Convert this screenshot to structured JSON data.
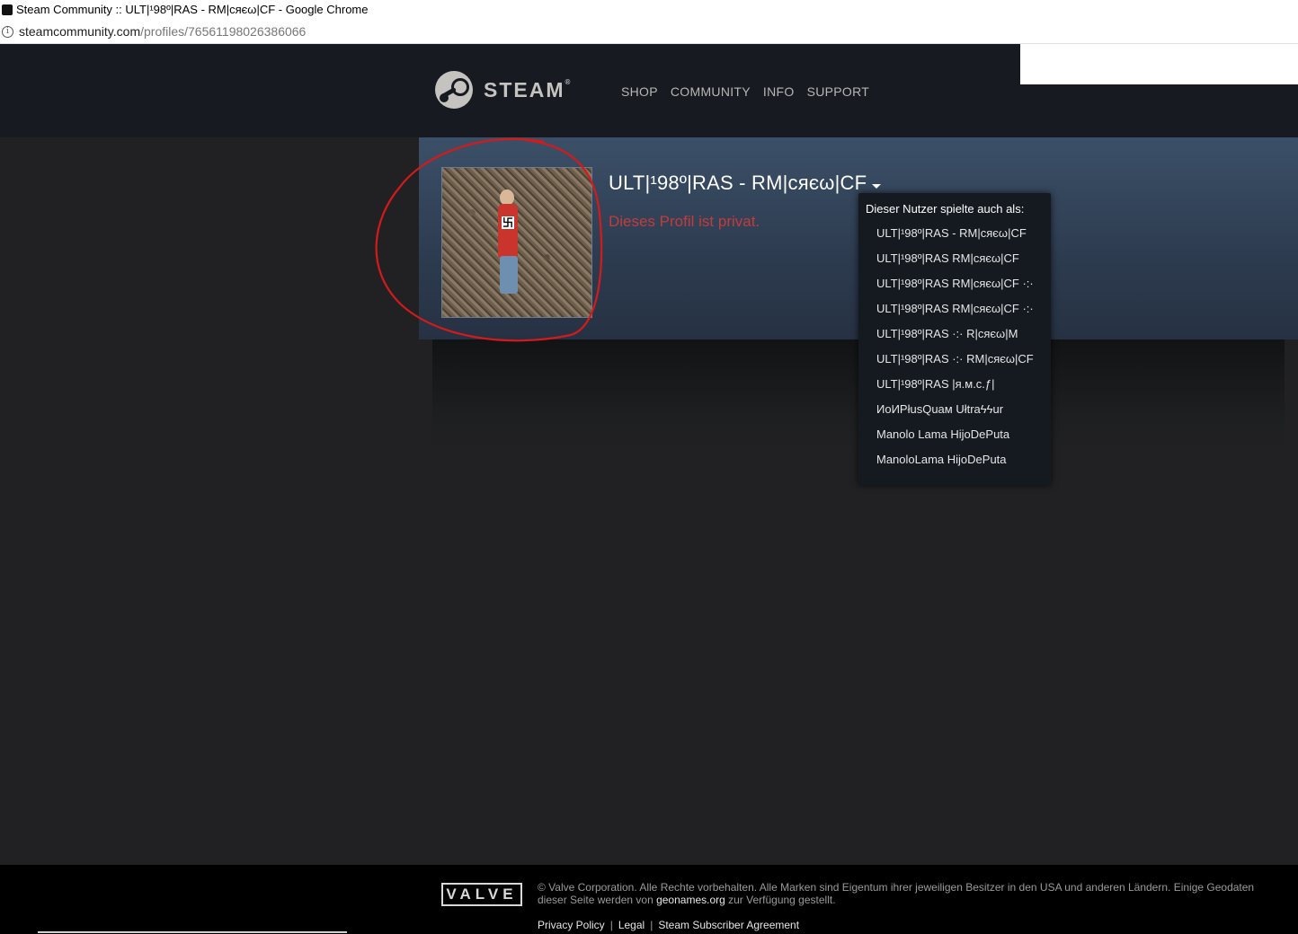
{
  "browser": {
    "title": "Steam Community :: ULT|¹98º|RAS - RM|cяєω|CF - Google Chrome",
    "url_host": "steamcommunity.com",
    "url_path": "/profiles/76561198026386066"
  },
  "header": {
    "logo_text": "STEAM",
    "logo_reg": "®",
    "nav": [
      "SHOP",
      "COMMUNITY",
      "INFO",
      "SUPPORT"
    ]
  },
  "profile": {
    "persona_name": "ULT|¹98º|RAS - RM|cяєω|CF",
    "private_text": "Dieses Profil ist privat."
  },
  "aliases": {
    "title": "Dieser Nutzer spielte auch als:",
    "items": [
      "ULT|¹98º|RAS - RM|cяєω|CF",
      "ULT|¹98º|RAS RM|cяєω|CF",
      "ULT|¹98º|RAS RM|cяєω|CF ·:·",
      "ULT|¹98º|RAS RM|cяєω|CF ·:·",
      "ULT|¹98º|RAS ·:· R|cяєω|M",
      "ULT|¹98º|RAS ·:· RM|cяєω|CF",
      "ULT|¹98º|RAS |я.м.c.ƒ|",
      "ИoИPłusQuaм Ułtraϟϟur",
      "Manolo Lama HijoDePuta",
      "ManoloLama HijoDePuta"
    ]
  },
  "footer": {
    "valve": "VALVE",
    "copyright_before": "© Valve Corporation. Alle Rechte vorbehalten. Alle Marken sind Eigentum ihrer jeweiligen Besitzer in den USA und anderen Ländern. Einige Geodaten dieser Seite werden von ",
    "geonames": "geonames.org",
    "copyright_after": " zur Verfügung gestellt.",
    "links": [
      "Privacy Policy",
      "Legal",
      "Steam Subscriber Agreement"
    ],
    "separator": "|"
  }
}
